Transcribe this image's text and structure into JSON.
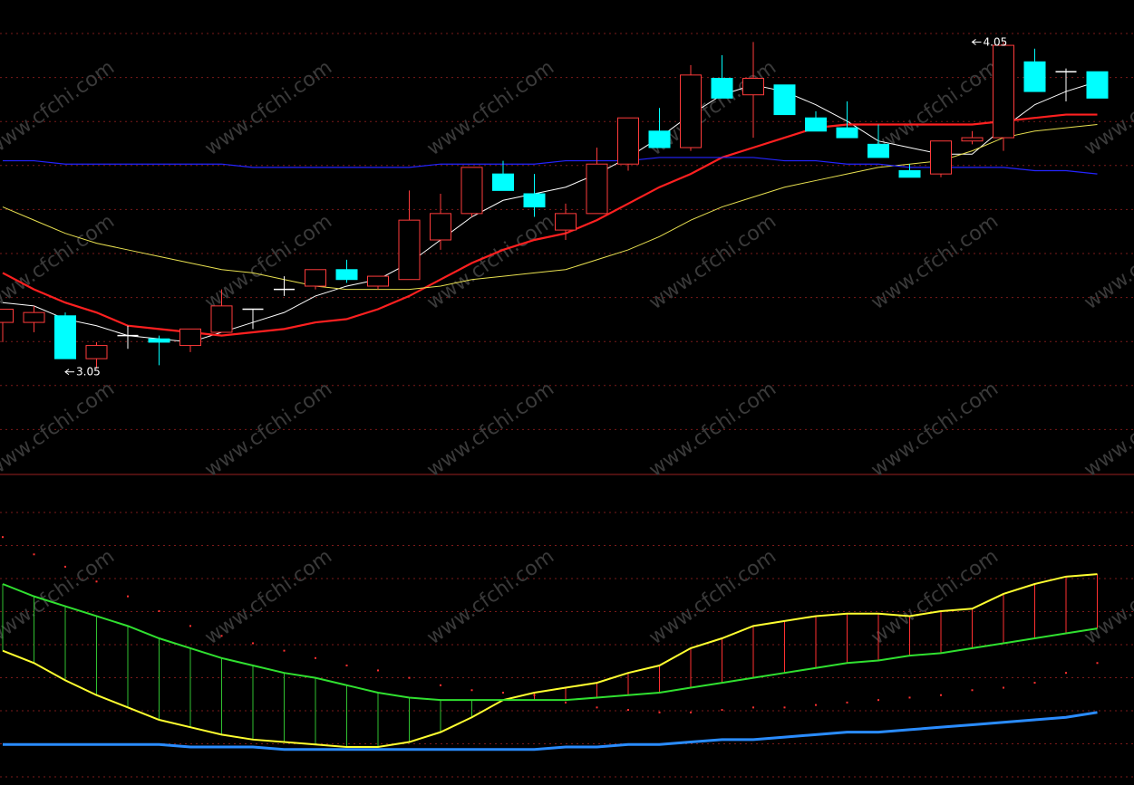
{
  "watermark": "www.cfchi.com",
  "colors": {
    "background": "#000000",
    "up": "#ff3b3b",
    "down": "#00ffff",
    "doji": "#ffffff",
    "ma_short": "#ffffff",
    "ma_mid": "#ff2020",
    "ma_long": "#e8e050",
    "ma_longest": "#2424ff",
    "grid": "#7a1a1a",
    "divider": "#9a2020",
    "hist_up": "#ff3030",
    "hist_down": "#30c030",
    "ind_fast": "#ffff30",
    "ind_slow": "#30e030",
    "ind_base": "#2a8cff",
    "ind_dots": "#ff3030",
    "marker": "#ffffff"
  },
  "chart_data": [
    {
      "type": "candlestick",
      "ylim": [
        2.75,
        4.15
      ],
      "grid": true,
      "annotations": [
        {
          "text": "4.05",
          "candle": 31,
          "value": 4.05
        },
        {
          "text": "3.05",
          "candle": 2,
          "value": 3.05
        }
      ],
      "candles": [
        {
          "o": 3.2,
          "h": 3.24,
          "l": 3.14,
          "c": 3.24
        },
        {
          "o": 3.2,
          "h": 3.25,
          "l": 3.17,
          "c": 3.23
        },
        {
          "o": 3.22,
          "h": 3.23,
          "l": 3.09,
          "c": 3.09
        },
        {
          "o": 3.09,
          "h": 3.14,
          "l": 3.06,
          "c": 3.13
        },
        {
          "o": 3.16,
          "h": 3.19,
          "l": 3.12,
          "c": 3.16
        },
        {
          "o": 3.15,
          "h": 3.16,
          "l": 3.07,
          "c": 3.14
        },
        {
          "o": 3.13,
          "h": 3.17,
          "l": 3.11,
          "c": 3.18
        },
        {
          "o": 3.17,
          "h": 3.3,
          "l": 3.17,
          "c": 3.25
        },
        {
          "o": 3.24,
          "h": 3.24,
          "l": 3.18,
          "c": 3.24
        },
        {
          "o": 3.3,
          "h": 3.34,
          "l": 3.28,
          "c": 3.3
        },
        {
          "o": 3.31,
          "h": 3.36,
          "l": 3.3,
          "c": 3.36
        },
        {
          "o": 3.36,
          "h": 3.39,
          "l": 3.32,
          "c": 3.33
        },
        {
          "o": 3.31,
          "h": 3.34,
          "l": 3.3,
          "c": 3.34
        },
        {
          "o": 3.33,
          "h": 3.6,
          "l": 3.33,
          "c": 3.51
        },
        {
          "o": 3.45,
          "h": 3.59,
          "l": 3.42,
          "c": 3.53
        },
        {
          "o": 3.53,
          "h": 3.67,
          "l": 3.52,
          "c": 3.67
        },
        {
          "o": 3.65,
          "h": 3.69,
          "l": 3.6,
          "c": 3.6
        },
        {
          "o": 3.59,
          "h": 3.65,
          "l": 3.52,
          "c": 3.55
        },
        {
          "o": 3.48,
          "h": 3.56,
          "l": 3.45,
          "c": 3.53
        },
        {
          "o": 3.53,
          "h": 3.73,
          "l": 3.53,
          "c": 3.68
        },
        {
          "o": 3.68,
          "h": 3.82,
          "l": 3.66,
          "c": 3.82
        },
        {
          "o": 3.78,
          "h": 3.85,
          "l": 3.73,
          "c": 3.73
        },
        {
          "o": 3.73,
          "h": 3.98,
          "l": 3.72,
          "c": 3.95
        },
        {
          "o": 3.94,
          "h": 4.01,
          "l": 3.88,
          "c": 3.88
        },
        {
          "o": 3.89,
          "h": 4.05,
          "l": 3.76,
          "c": 3.94
        },
        {
          "o": 3.92,
          "h": 3.92,
          "l": 3.83,
          "c": 3.83
        },
        {
          "o": 3.82,
          "h": 3.84,
          "l": 3.78,
          "c": 3.78
        },
        {
          "o": 3.79,
          "h": 3.87,
          "l": 3.77,
          "c": 3.76
        },
        {
          "o": 3.74,
          "h": 3.8,
          "l": 3.7,
          "c": 3.7
        },
        {
          "o": 3.66,
          "h": 3.68,
          "l": 3.64,
          "c": 3.64
        },
        {
          "o": 3.65,
          "h": 3.75,
          "l": 3.64,
          "c": 3.75
        },
        {
          "o": 3.75,
          "h": 3.78,
          "l": 3.74,
          "c": 3.76
        },
        {
          "o": 3.76,
          "h": 4.05,
          "l": 3.72,
          "c": 4.04
        },
        {
          "o": 3.99,
          "h": 4.03,
          "l": 3.9,
          "c": 3.9
        },
        {
          "o": 3.96,
          "h": 3.97,
          "l": 3.87,
          "c": 3.96
        },
        {
          "o": 3.96,
          "h": 3.96,
          "l": 3.88,
          "c": 3.88
        }
      ],
      "series": [
        {
          "key": "ma_short",
          "values": [
            3.26,
            3.25,
            3.21,
            3.19,
            3.16,
            3.15,
            3.14,
            3.17,
            3.2,
            3.23,
            3.28,
            3.31,
            3.33,
            3.38,
            3.45,
            3.52,
            3.57,
            3.59,
            3.61,
            3.65,
            3.7,
            3.76,
            3.83,
            3.89,
            3.92,
            3.9,
            3.86,
            3.81,
            3.75,
            3.73,
            3.71,
            3.71,
            3.79,
            3.86,
            3.9,
            3.93
          ]
        },
        {
          "key": "ma_mid",
          "values": [
            3.35,
            3.3,
            3.26,
            3.23,
            3.19,
            3.18,
            3.17,
            3.16,
            3.17,
            3.18,
            3.2,
            3.21,
            3.24,
            3.28,
            3.33,
            3.38,
            3.42,
            3.45,
            3.47,
            3.51,
            3.56,
            3.61,
            3.65,
            3.7,
            3.73,
            3.76,
            3.79,
            3.8,
            3.8,
            3.8,
            3.8,
            3.8,
            3.81,
            3.82,
            3.83,
            3.83
          ]
        },
        {
          "key": "ma_long",
          "values": [
            3.55,
            3.51,
            3.47,
            3.44,
            3.42,
            3.4,
            3.38,
            3.36,
            3.35,
            3.33,
            3.31,
            3.3,
            3.3,
            3.3,
            3.31,
            3.33,
            3.34,
            3.35,
            3.36,
            3.39,
            3.42,
            3.46,
            3.51,
            3.55,
            3.58,
            3.61,
            3.63,
            3.65,
            3.67,
            3.68,
            3.69,
            3.72,
            3.76,
            3.78,
            3.79,
            3.8
          ]
        },
        {
          "key": "ma_longest",
          "values": [
            3.69,
            3.69,
            3.68,
            3.68,
            3.68,
            3.68,
            3.68,
            3.68,
            3.67,
            3.67,
            3.67,
            3.67,
            3.67,
            3.67,
            3.68,
            3.68,
            3.68,
            3.68,
            3.69,
            3.69,
            3.69,
            3.7,
            3.7,
            3.7,
            3.7,
            3.69,
            3.69,
            3.68,
            3.68,
            3.67,
            3.67,
            3.67,
            3.67,
            3.66,
            3.66,
            3.65
          ]
        }
      ]
    },
    {
      "type": "line",
      "ylim": [
        -10,
        100
      ],
      "grid": true,
      "series": [
        {
          "key": "ind_fast",
          "values": [
            40,
            35,
            28,
            22,
            17,
            12,
            9,
            6,
            4,
            3,
            2,
            1,
            1,
            3,
            7,
            13,
            20,
            23,
            25,
            27,
            31,
            34,
            41,
            45,
            50,
            52,
            54,
            55,
            55,
            54,
            56,
            57,
            63,
            67,
            70,
            71
          ]
        },
        {
          "key": "ind_slow",
          "values": [
            67,
            62,
            58,
            54,
            50,
            45,
            41,
            37,
            34,
            31,
            29,
            26,
            23,
            21,
            20,
            20,
            20,
            20,
            20,
            21,
            22,
            23,
            25,
            27,
            29,
            31,
            33,
            35,
            36,
            38,
            39,
            41,
            43,
            45,
            47,
            49
          ]
        },
        {
          "key": "ind_base",
          "values": [
            2,
            2,
            2,
            2,
            2,
            2,
            1,
            1,
            1,
            0,
            0,
            0,
            0,
            0,
            0,
            0,
            0,
            0,
            1,
            1,
            2,
            2,
            3,
            4,
            4,
            5,
            6,
            7,
            7,
            8,
            9,
            10,
            11,
            12,
            13,
            15
          ]
        },
        {
          "key": "ind_dots",
          "values": [
            86,
            79,
            74,
            68,
            62,
            56,
            50,
            46,
            43,
            40,
            37,
            34,
            32,
            29,
            26,
            24,
            23,
            22,
            19,
            17,
            16,
            15,
            15,
            16,
            17,
            17,
            18,
            19,
            20,
            21,
            22,
            24,
            25,
            27,
            31,
            35
          ]
        }
      ]
    }
  ]
}
